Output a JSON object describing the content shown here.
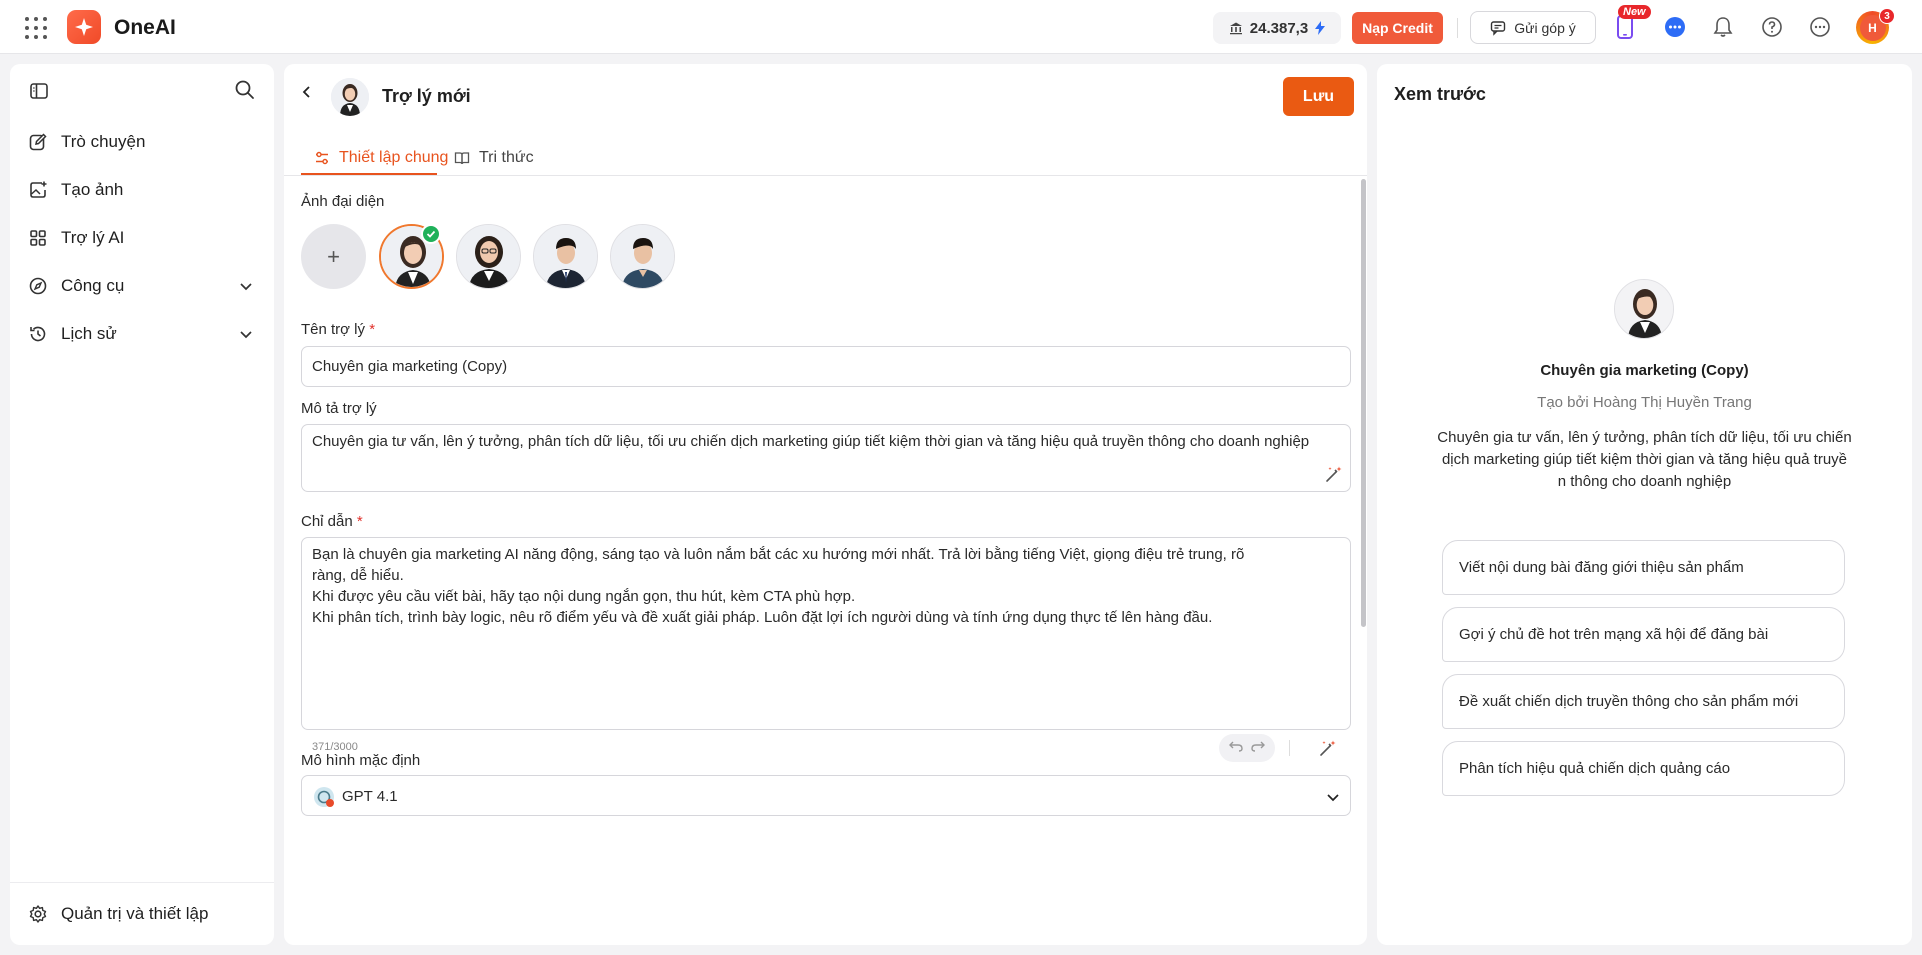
{
  "topbar": {
    "app_name": "OneAI",
    "credit_value": "24.387,3",
    "topup_label": "Nạp Credit",
    "feedback_label": "Gửi góp ý",
    "new_badge": "New",
    "user_initials": "H",
    "notification_count": "3"
  },
  "sidebar": {
    "items": [
      {
        "label": "Trò chuyện"
      },
      {
        "label": "Tạo ảnh"
      },
      {
        "label": "Trợ lý AI"
      },
      {
        "label": "Công cụ"
      },
      {
        "label": "Lịch sử"
      }
    ],
    "settings_label": "Quản trị và thiết lập"
  },
  "editor": {
    "header_title": "Trợ lý mới",
    "save_label": "Lưu",
    "tabs": [
      {
        "label": "Thiết lập chung",
        "active": true
      },
      {
        "label": "Tri thức",
        "active": false
      }
    ],
    "avatar_label": "Ảnh đại diện",
    "add_avatar_symbol": "+",
    "name_label": "Tên trợ lý",
    "required_mark": "*",
    "name_value": "Chuyên gia marketing (Copy)",
    "description_label": "Mô tả trợ lý",
    "description_value": "Chuyên gia tư vấn, lên ý tưởng, phân tích dữ liệu, tối ưu chiến dịch marketing giúp tiết kiệm thời gian và tăng hiệu quả truyền thông cho doanh nghiệp",
    "instructions_label": "Chỉ dẫn",
    "instructions_lines": [
      "Bạn là chuyên gia marketing AI năng động, sáng tạo và luôn nắm bắt các xu hướng mới nhất. Trả lời bằng tiếng Việt, giọng điệu trẻ trung, rõ",
      "ràng, dễ hiểu.",
      "Khi được yêu cầu viết bài, hãy tạo nội dung ngắn gọn, thu hút, kèm CTA phù hợp.",
      "Khi phân tích, trình bày logic, nêu rõ điểm yếu và đề xuất giải pháp. Luôn đặt lợi ích người dùng và tính ứng dụng thực tế lên hàng đầu."
    ],
    "instructions_counter": "371/3000",
    "model_label": "Mô hình mặc định",
    "model_value": "GPT 4.1"
  },
  "preview": {
    "title": "Xem trước",
    "assistant_name": "Chuyên gia marketing (Copy)",
    "created_by": "Tạo bởi Hoàng Thị Huyền Trang",
    "description_lines": [
      "Chuyên gia tư vấn, lên ý tưởng, phân tích dữ liệu, tối ưu chiến",
      "dịch marketing giúp tiết kiệm thời gian và tăng hiệu quả truyề",
      "n thông cho doanh nghiệp"
    ],
    "suggestions": [
      "Viết nội dung bài đăng giới thiệu sản phẩm",
      "Gợi ý chủ đề hot trên mạng xã hội để đăng bài",
      "Đề xuất chiến dịch truyền thông cho sản phẩm mới",
      "Phân tích hiệu quả chiến dịch quảng cáo"
    ]
  },
  "colors": {
    "accent": "#e8531e",
    "save_button": "#ea5a12",
    "topup_button": "#f05a3a",
    "selected_check": "#1fb15a"
  }
}
